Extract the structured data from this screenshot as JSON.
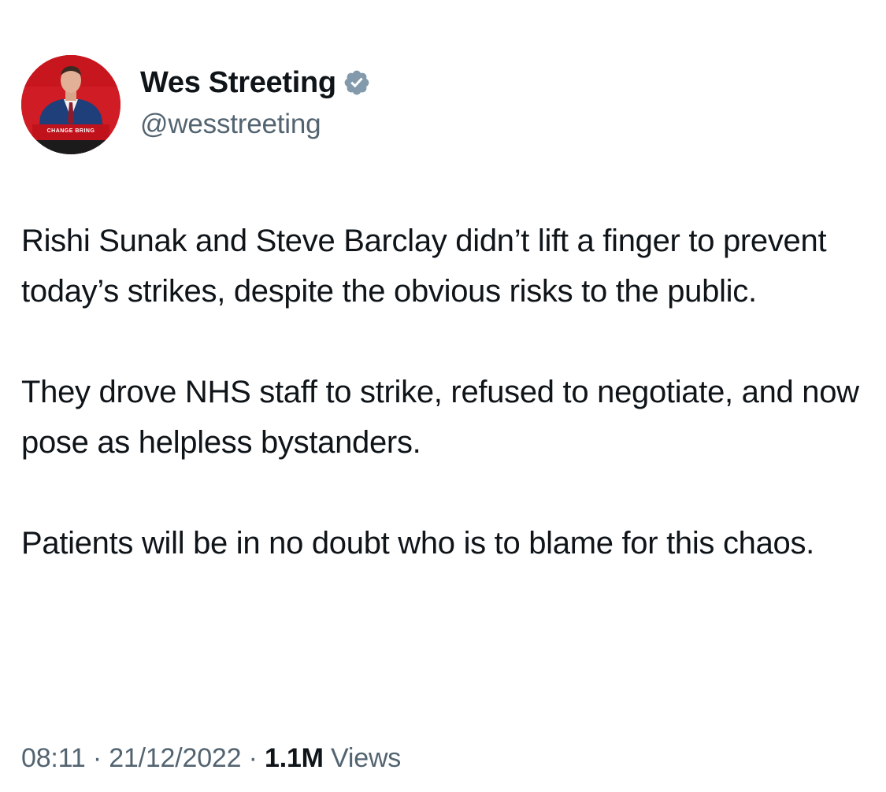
{
  "author": {
    "display_name": "Wes Streeting",
    "handle": "@wesstreeting",
    "verified": true,
    "verified_icon": "verified-badge-icon",
    "verified_color": "#829aab",
    "avatar_lectern_text": "CHANGE BRING"
  },
  "tweet": {
    "paragraphs": [
      "Rishi Sunak and Steve Barclay didn’t lift a finger to prevent today’s strikes, despite the obvious risks to the public.",
      "They drove NHS staff to strike, refused to negotiate, and now pose as helpless bystanders.",
      "Patients will be in no doubt who is to blame for this chaos."
    ]
  },
  "meta": {
    "time": "08:11",
    "separator": "·",
    "date": "21/12/2022",
    "views_count": "1.1M",
    "views_label": "Views"
  },
  "colors": {
    "text_primary": "#0f1419",
    "text_secondary": "#536471",
    "avatar_background": "#d01c24"
  }
}
